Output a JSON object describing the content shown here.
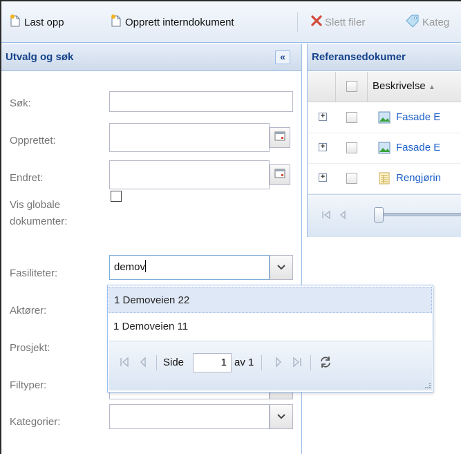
{
  "toolbar": {
    "upload_label": "Last opp",
    "create_internal_label": "Opprett interndokument",
    "delete_label": "Slett filer",
    "categorize_label": "Kateg"
  },
  "left_panel": {
    "title": "Utvalg og søk",
    "collapse_glyph": "«",
    "labels": {
      "search": "Søk:",
      "created": "Opprettet:",
      "changed": "Endret:",
      "global_line1": "Vis globale",
      "global_line2": "dokumenter:",
      "facilities": "Fasiliteter:",
      "actors": "Aktører:",
      "project": "Prosjekt:",
      "filetypes": "Filtyper:",
      "categories": "Kategorier:"
    },
    "facilities_value": "demov",
    "show_global_checked": false
  },
  "combo_list": {
    "options": [
      "1 Demoveien 22",
      "1 Demoveien 11"
    ],
    "pager": {
      "page_label": "Side",
      "page_value": "1",
      "of_label": "av 1"
    }
  },
  "right_panel": {
    "title": "Referansedokumer",
    "column_header": "Beskrivelse",
    "rows": [
      {
        "label": "Fasade E",
        "icon": "image-icon"
      },
      {
        "label": "Fasade E",
        "icon": "image-icon"
      },
      {
        "label": "Rengjørin",
        "icon": "table-doc-icon"
      }
    ]
  }
}
